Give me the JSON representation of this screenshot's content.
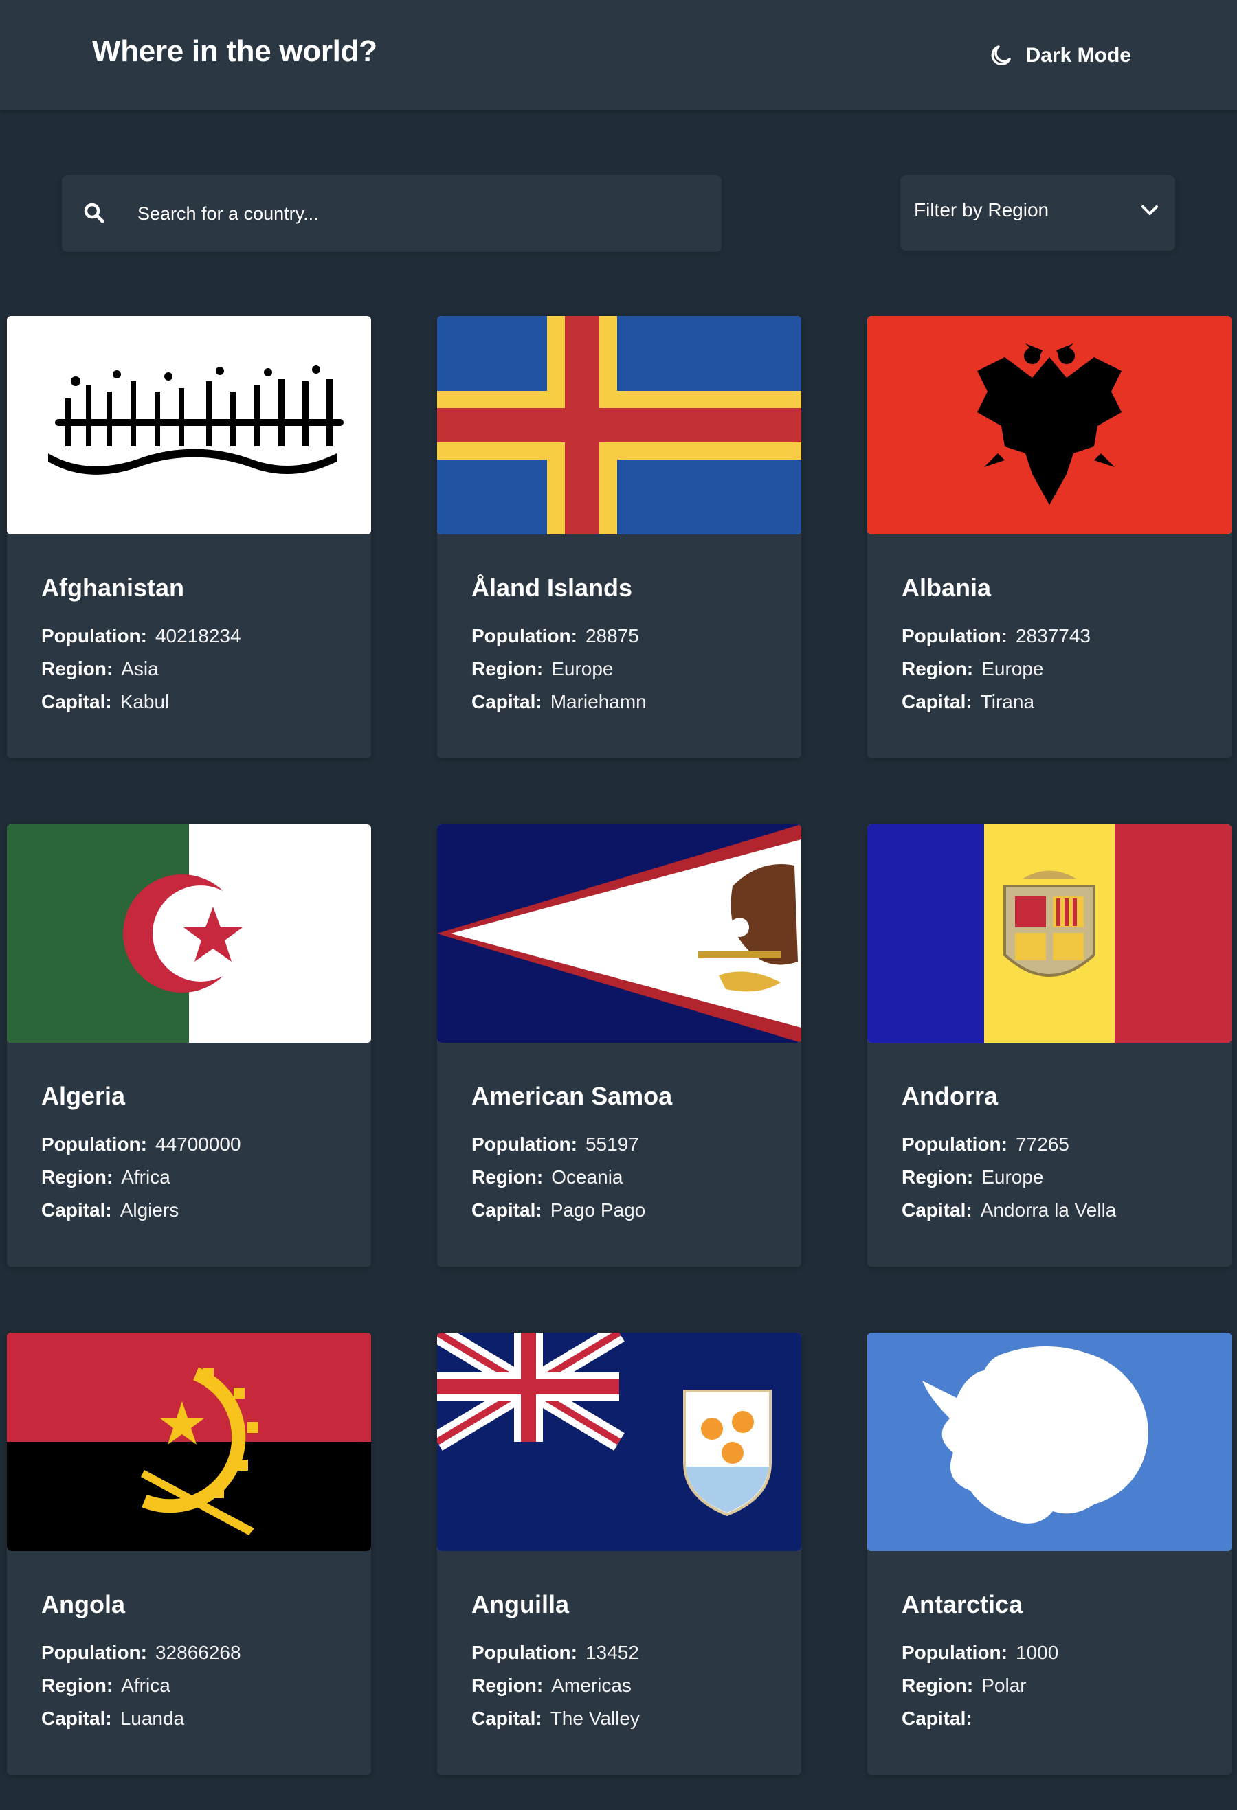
{
  "header": {
    "title": "Where in the world?",
    "dark_mode_label": "Dark Mode",
    "icon": "moon-icon"
  },
  "search": {
    "placeholder": "Search for a country...",
    "value": "",
    "icon": "search-icon"
  },
  "filter": {
    "label": "Filter by Region",
    "icon": "chevron-down-icon"
  },
  "labels": {
    "population": "Population:",
    "region": "Region:",
    "capital": "Capital:"
  },
  "colors": {
    "background": "#202c37",
    "element": "#2b3743",
    "text": "#ffffff"
  },
  "countries": [
    {
      "name": "Afghanistan",
      "population": "40218234",
      "region": "Asia",
      "capital": "Kabul"
    },
    {
      "name": "Åland Islands",
      "population": "28875",
      "region": "Europe",
      "capital": "Mariehamn"
    },
    {
      "name": "Albania",
      "population": "2837743",
      "region": "Europe",
      "capital": "Tirana"
    },
    {
      "name": "Algeria",
      "population": "44700000",
      "region": "Africa",
      "capital": "Algiers"
    },
    {
      "name": "American Samoa",
      "population": "55197",
      "region": "Oceania",
      "capital": "Pago Pago"
    },
    {
      "name": "Andorra",
      "population": "77265",
      "region": "Europe",
      "capital": "Andorra la Vella"
    },
    {
      "name": "Angola",
      "population": "32866268",
      "region": "Africa",
      "capital": "Luanda"
    },
    {
      "name": "Anguilla",
      "population": "13452",
      "region": "Americas",
      "capital": "The Valley"
    },
    {
      "name": "Antarctica",
      "population": "1000",
      "region": "Polar",
      "capital": ""
    }
  ]
}
